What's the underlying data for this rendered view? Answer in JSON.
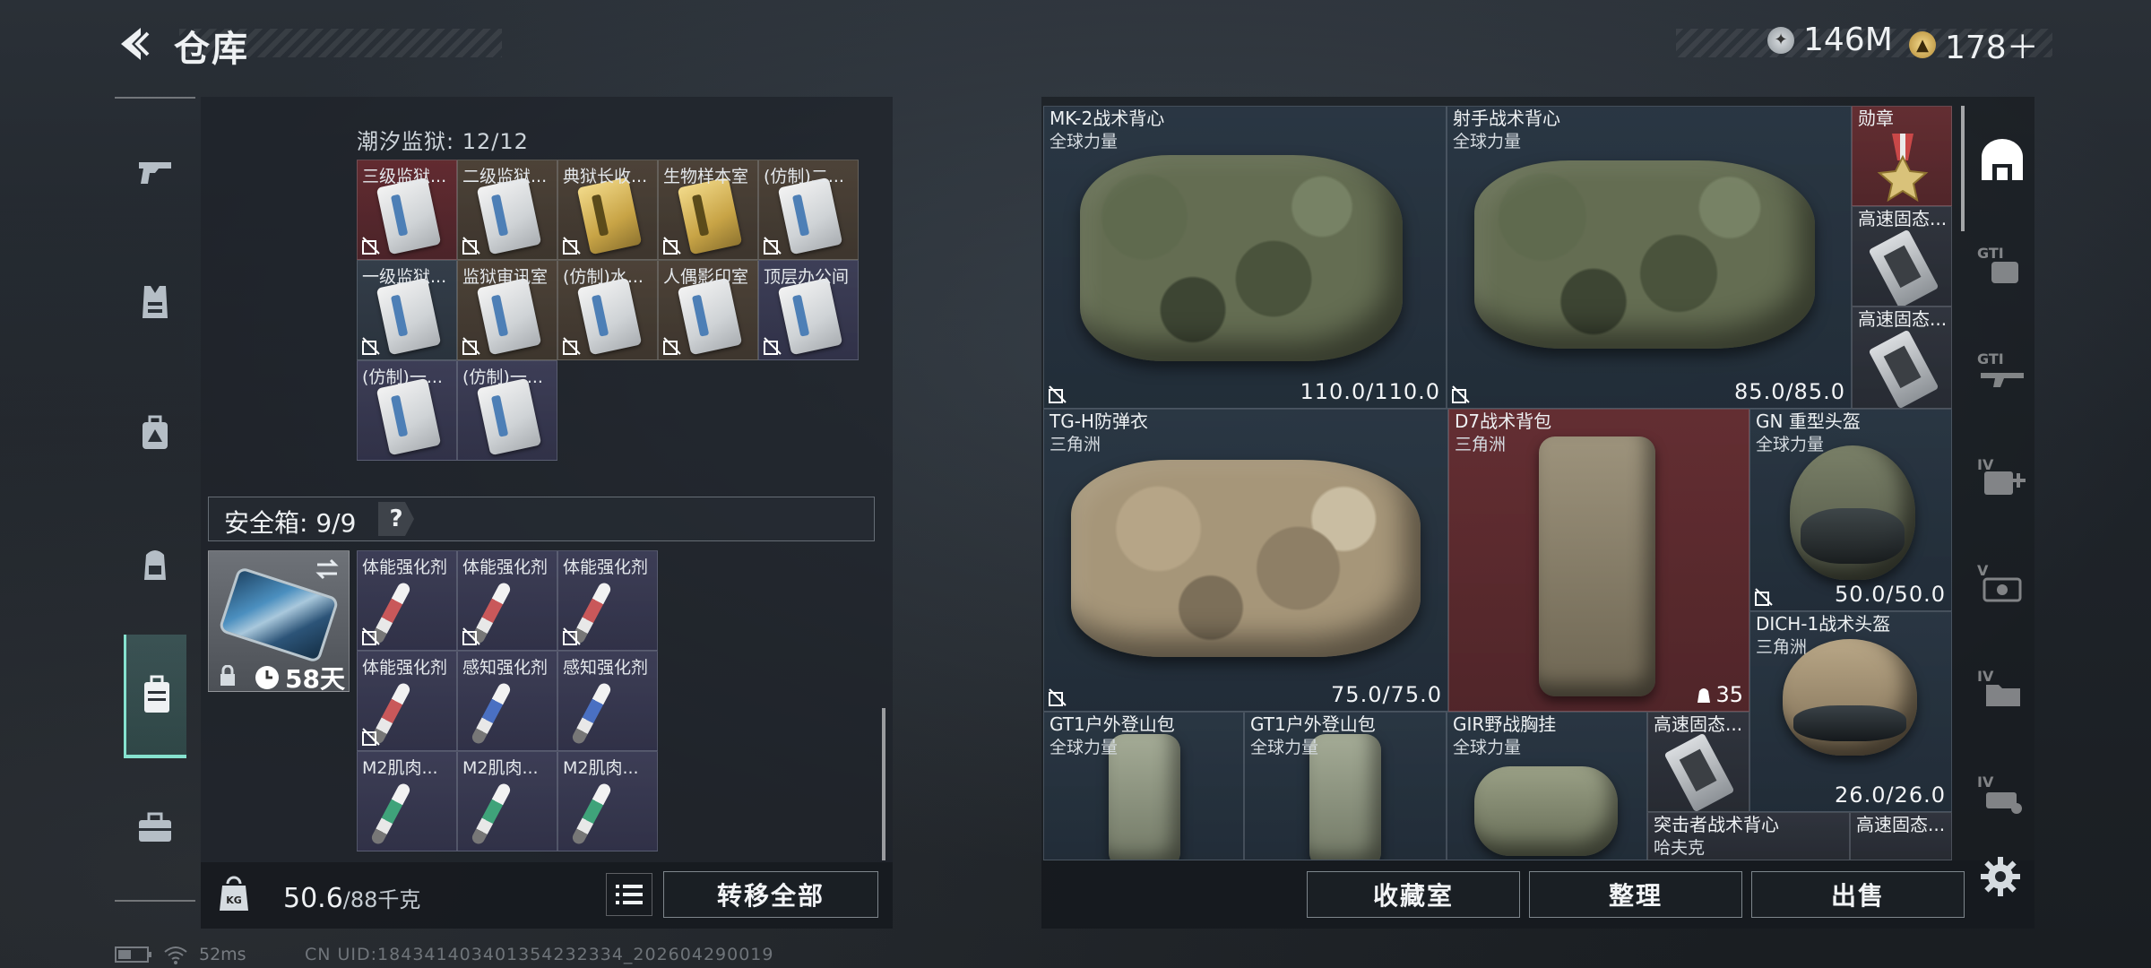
{
  "header": {
    "title": "仓库",
    "currency": [
      {
        "icon": "silver-coin-icon",
        "value": "146M"
      },
      {
        "icon": "gold-coin-icon",
        "value": "178＋"
      }
    ]
  },
  "left_nav": {
    "items": [
      {
        "icon": "gun-icon"
      },
      {
        "icon": "vest-icon"
      },
      {
        "icon": "medkit-bag-icon"
      },
      {
        "icon": "backpack-icon"
      },
      {
        "icon": "storage-container-icon",
        "active": true
      },
      {
        "icon": "briefcase-icon"
      }
    ]
  },
  "prison": {
    "label": "潮汐监狱: 12/12",
    "cards": [
      {
        "label": "三级监狱...",
        "tone": "red",
        "card": "silver"
      },
      {
        "label": "二级监狱...",
        "tone": "brown",
        "card": "silver"
      },
      {
        "label": "典狱长收...",
        "tone": "brown",
        "card": "gold"
      },
      {
        "label": "生物样本室",
        "tone": "brown",
        "card": "gold"
      },
      {
        "label": "(仿制)二...",
        "tone": "brown",
        "card": "silver"
      },
      {
        "label": "一级监狱...",
        "tone": "teal",
        "card": "silver"
      },
      {
        "label": "监狱审讯室",
        "tone": "brown",
        "card": "silver"
      },
      {
        "label": "(仿制)水...",
        "tone": "brown",
        "card": "silver"
      },
      {
        "label": "人偶影印室",
        "tone": "brown",
        "card": "silver"
      },
      {
        "label": "顶层办公间",
        "tone": "purple",
        "card": "silver"
      },
      {
        "label": "(仿制)一...",
        "tone": "purple",
        "card": "silver"
      },
      {
        "label": "(仿制)一...",
        "tone": "purple",
        "card": "silver"
      }
    ]
  },
  "safe": {
    "title": "安全箱: 9/9",
    "help": "?",
    "days": "58天",
    "items": [
      {
        "label": "体能强化剂",
        "color": "#c9585a"
      },
      {
        "label": "体能强化剂",
        "color": "#c9585a"
      },
      {
        "label": "体能强化剂",
        "color": "#c9585a"
      },
      {
        "label": "体能强化剂",
        "color": "#c9585a"
      },
      {
        "label": "感知强化剂",
        "color": "#4a70c2"
      },
      {
        "label": "感知强化剂",
        "color": "#4a70c2"
      },
      {
        "label": "M2肌肉...",
        "color": "#3fa37a"
      },
      {
        "label": "M2肌肉...",
        "color": "#3fa37a"
      },
      {
        "label": "M2肌肉...",
        "color": "#3fa37a"
      }
    ]
  },
  "weight": {
    "current": "50.6",
    "max": "/88千克"
  },
  "buttons": {
    "transfer_all": "转移全部",
    "collection": "收藏室",
    "sort": "整理",
    "sell": "出售"
  },
  "stash": {
    "mk2": {
      "name": "MK-2战术背心",
      "source": "全球力量",
      "durability": "110.0/110.0"
    },
    "shooter": {
      "name": "射手战术背心",
      "source": "全球力量",
      "durability": "85.0/85.0"
    },
    "medal": {
      "name": "勋章"
    },
    "ssd1": {
      "name": "高速固态..."
    },
    "ssd2": {
      "name": "高速固态..."
    },
    "tgh": {
      "name": "TG-H防弹衣",
      "source": "三角洲",
      "durability": "75.0/75.0"
    },
    "d7": {
      "name": "D7战术背包",
      "source": "三角洲",
      "capacity": "35"
    },
    "gn": {
      "name": "GN 重型头盔",
      "source": "全球力量",
      "durability": "50.0/50.0"
    },
    "dich": {
      "name": "DICH-1战术头盔",
      "source": "三角洲",
      "durability": "26.0/26.0"
    },
    "gt1a": {
      "name": "GT1户外登山包",
      "source": "全球力量"
    },
    "gt1b": {
      "name": "GT1户外登山包",
      "source": "全球力量"
    },
    "gir": {
      "name": "GIR野战胸挂",
      "source": "全球力量"
    },
    "ssd3": {
      "name": "高速固态..."
    },
    "assault": {
      "name": "突击者战术背心",
      "source": "哈夫克"
    },
    "ssd4": {
      "name": "高速固态..."
    }
  },
  "right_tabs": [
    {
      "icon": "all-items-icon",
      "active": true
    },
    {
      "icon": "gti-backpack-icon"
    },
    {
      "icon": "gti-rifle-icon"
    },
    {
      "icon": "iv-medical-icon"
    },
    {
      "icon": "v-keycard-icon"
    },
    {
      "icon": "iv-folder-icon"
    },
    {
      "icon": "iv-misc-icon"
    }
  ],
  "status": {
    "ping": "52ms",
    "uid": "CN UID:1843414034013542323​34_202604290019"
  }
}
